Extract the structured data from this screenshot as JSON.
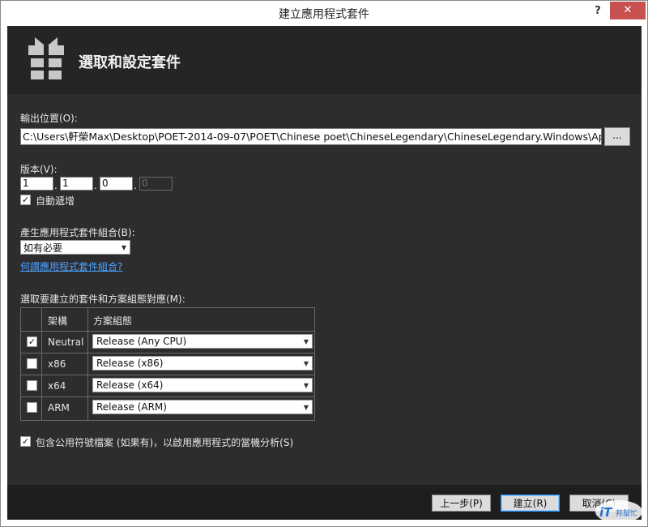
{
  "window": {
    "title": "建立應用程式套件",
    "help_label": "?",
    "close_label": "✕"
  },
  "header": {
    "title": "選取和設定套件",
    "icon": "package-gift-icon"
  },
  "output": {
    "label": "輸出位置(O):",
    "value": "C:\\Users\\軒榮Max\\Desktop\\POET-2014-09-07\\POET\\Chinese poet\\ChineseLegendary\\ChineseLegendary.Windows\\AppPackages\\",
    "browse_label": "..."
  },
  "version": {
    "label": "版本(V):",
    "major": "1",
    "minor": "1",
    "build": "0",
    "revision": "0",
    "auto_increment_label": "自動遞增",
    "auto_increment_checked": true
  },
  "bundle": {
    "label": "產生應用程式套件組合(B):",
    "selected": "如有必要",
    "help_link": "何謂應用程式套件組合?"
  },
  "packages": {
    "label": "選取要建立的套件和方案組態對應(M):",
    "columns": [
      "架構",
      "方案組態"
    ],
    "rows": [
      {
        "arch": "Neutral",
        "config": "Release (Any CPU)",
        "checked": true
      },
      {
        "arch": "x86",
        "config": "Release (x86)",
        "checked": false
      },
      {
        "arch": "x64",
        "config": "Release (x64)",
        "checked": false
      },
      {
        "arch": "ARM",
        "config": "Release (ARM)",
        "checked": false
      }
    ]
  },
  "symbols": {
    "label": "包含公用符號檔案 (如果有)，以啟用應用程式的當機分析(S)",
    "checked": true
  },
  "footer": {
    "back_label": "上一步(P)",
    "create_label": "建立(R)",
    "cancel_label": "取消(C)"
  },
  "watermark": {
    "text": "iT邦幫忙"
  },
  "colors": {
    "body_bg": "#2d2d30",
    "header_bg": "#252526",
    "footer_bg": "#1e1e1e",
    "link": "#4aa3ff",
    "close_button": "#c75050"
  }
}
